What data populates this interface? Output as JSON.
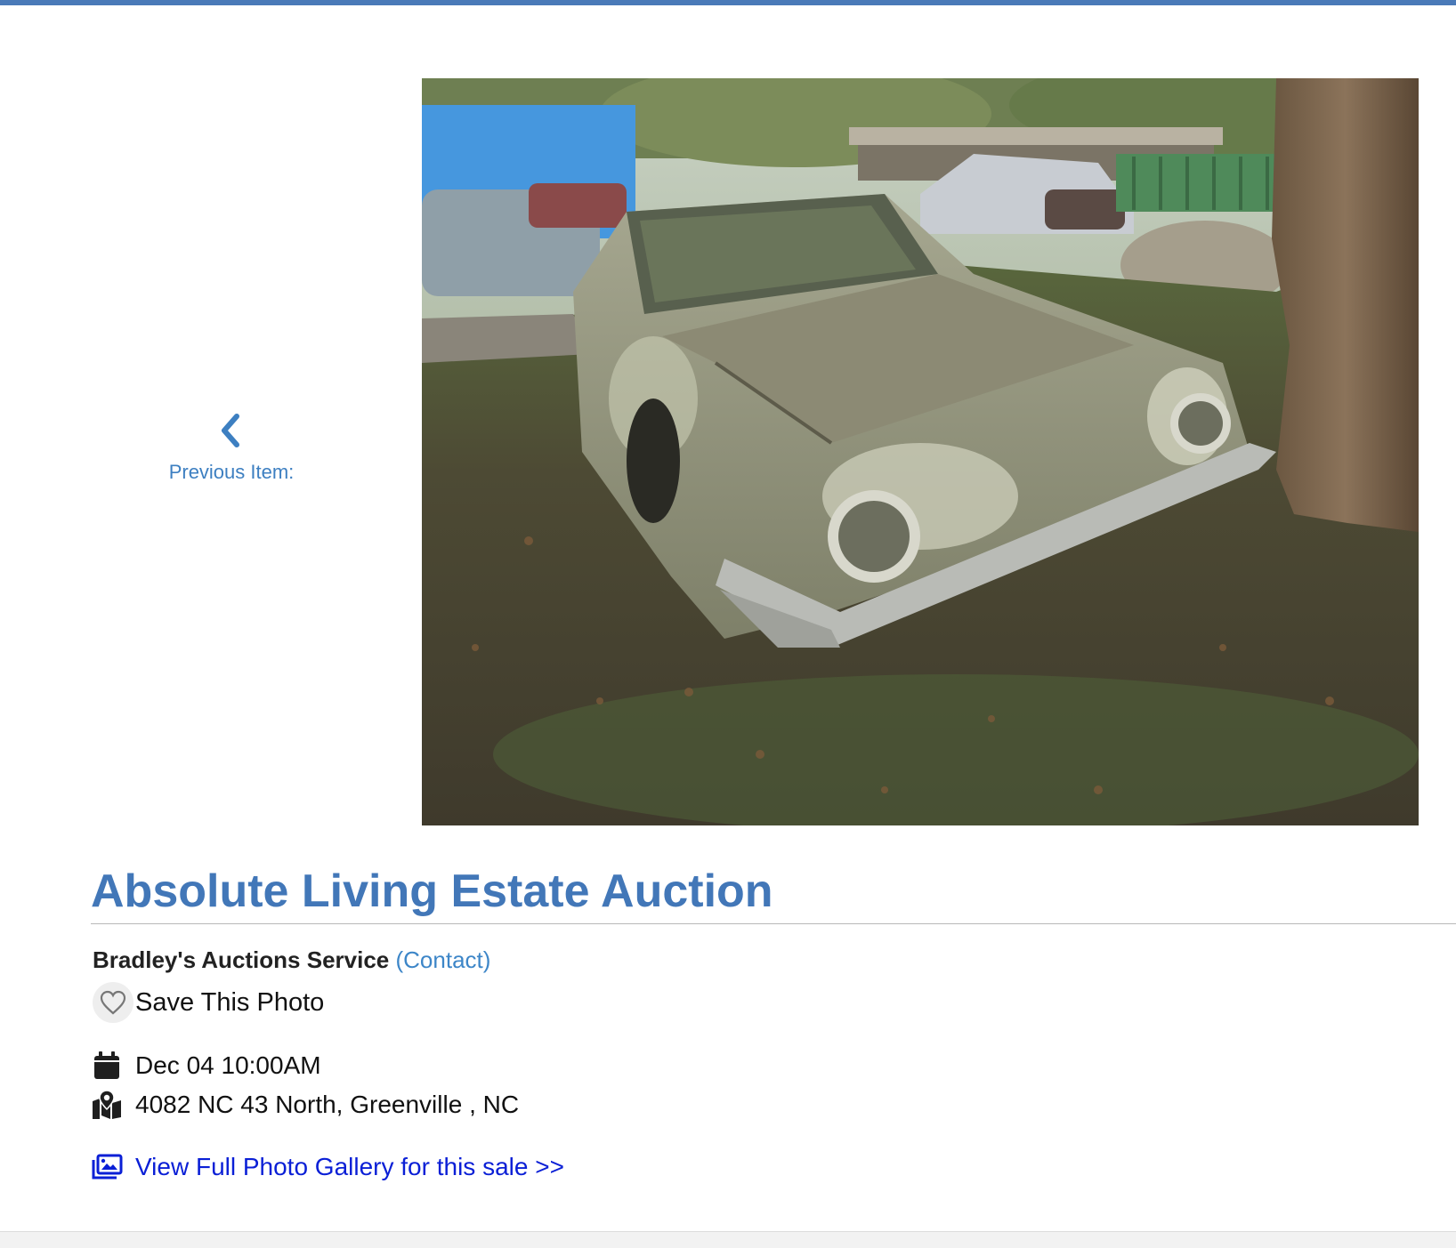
{
  "nav": {
    "previous_label": "Previous Item:"
  },
  "photo": {
    "alt": "Old abandoned car parked under a tree"
  },
  "sale": {
    "title": "Absolute Living Estate Auction",
    "company": "Bradley's Auctions Service",
    "contact_label": "(Contact)",
    "save_label": "Save This Photo",
    "date": "Dec 04 10:00AM",
    "address": "4082 NC 43 North, Greenville , NC",
    "gallery_link": "View Full Photo Gallery for this sale >>"
  },
  "colors": {
    "accent": "#4277b8",
    "top_bar": "#4a7ab8",
    "link": "#0a1fd6",
    "contact": "#3d86c8"
  },
  "icons": {
    "previous": "chevron-left-icon",
    "save": "heart-icon",
    "date": "calendar-icon",
    "address": "map-marker-icon",
    "gallery": "photo-gallery-icon"
  }
}
